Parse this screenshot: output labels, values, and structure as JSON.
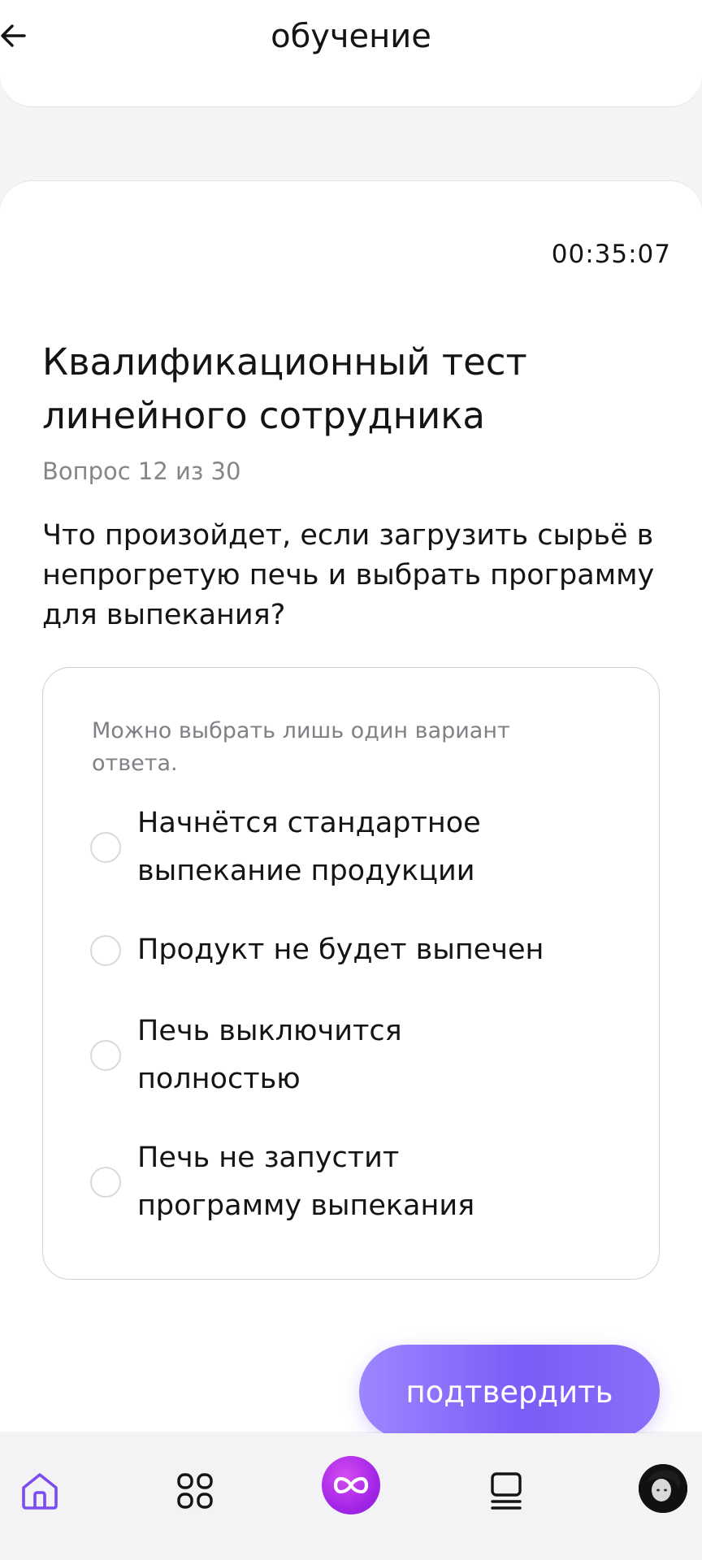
{
  "header": {
    "title": "обучение",
    "back_icon": "arrow-left-icon"
  },
  "test": {
    "timer": "00:35:07",
    "title": "Квалификационный тест линейного сотрудника",
    "counter": "Вопрос 12 из 30",
    "question": "Что произойдет, если загрузить сырьё в непрогретую печь и выбрать программу для выпекания?",
    "hint": "Можно выбрать лишь один вариант ответа.",
    "options": [
      {
        "label": "Начнётся стандартное выпекание продукции",
        "selected": false
      },
      {
        "label": "Продукт не будет выпечен",
        "selected": false
      },
      {
        "label": "Печь выключится полностью",
        "selected": false
      },
      {
        "label": "Печь не запустит программу выпекания",
        "selected": false
      }
    ],
    "confirm_label": "подтвердить"
  },
  "colors": {
    "accent": "#7b5cf7",
    "accent_light": "#9d86ff",
    "nav_active": "#7b4cf0",
    "center_button": "#a426e8"
  },
  "bottom_nav": {
    "items": [
      {
        "icon": "home-icon",
        "active": true
      },
      {
        "icon": "grid-icon",
        "active": false
      },
      {
        "icon": "infinity-icon",
        "active": false
      },
      {
        "icon": "list-icon",
        "active": false
      },
      {
        "icon": "avatar",
        "active": false
      }
    ]
  }
}
